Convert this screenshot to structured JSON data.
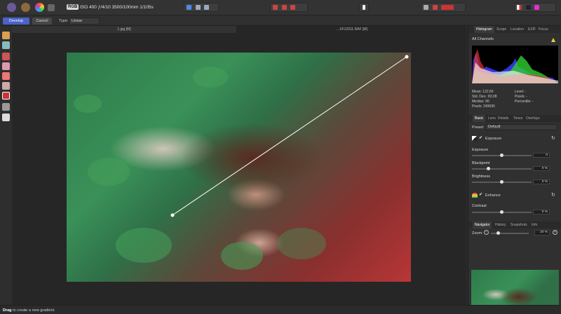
{
  "toolbar": {
    "color_mode": "RGB",
    "exif": "ISO 400 ƒ/4/10 3500/100mm 1/105s",
    "icons": [
      "develop-persona-icon",
      "liquify-persona-icon",
      "photo-persona-icon",
      "share-icon"
    ]
  },
  "modebar": {
    "develop_label": "Develop",
    "cancel_label": "Cancel",
    "type_label": "Type:",
    "type_value": "Linear"
  },
  "doctabs": {
    "tab1": "1.jpg [M]",
    "tab2": "...XF12011.RAF [M]"
  },
  "histogram_panel": {
    "tabs": [
      "Histogram",
      "Scope",
      "Location",
      "EXIF",
      "Focus"
    ],
    "channel": "All Channels",
    "stats_left": [
      "Mean: 122.60",
      "Std. Dev.: 83.08",
      "Median: 96",
      "Pixels: 249695"
    ],
    "stats_right": [
      "Level: -",
      "Pixels: -",
      "Percentile: -"
    ]
  },
  "basic_panel": {
    "tabs": [
      "Basic",
      "Lens",
      "Details",
      "Tones",
      "Overlays"
    ],
    "preset_label": "Preset:",
    "preset_value": "Default",
    "exposure_section": "Exposure",
    "enhance_section": "Enhance",
    "sliders": [
      {
        "label": "Exposure",
        "value": "0",
        "level": 0.5
      },
      {
        "label": "Blackpoint",
        "value": "0 %",
        "level": 0.28
      },
      {
        "label": "Brightness",
        "value": "0 %",
        "level": 0.5
      },
      {
        "label": "Contrast",
        "value": "0 %",
        "level": 0.5
      }
    ]
  },
  "navigator_panel": {
    "tabs": [
      "Navigator",
      "History",
      "Snapshots",
      "Info"
    ],
    "zoom_label": "Zoom:",
    "zoom_value": "20 %",
    "zoom_level": 0.2
  },
  "status": {
    "bold": "Drag",
    "text": " to create a new gradient."
  },
  "colors": {
    "accent": "#4a63c9",
    "gradient_line": "#ffffff"
  }
}
